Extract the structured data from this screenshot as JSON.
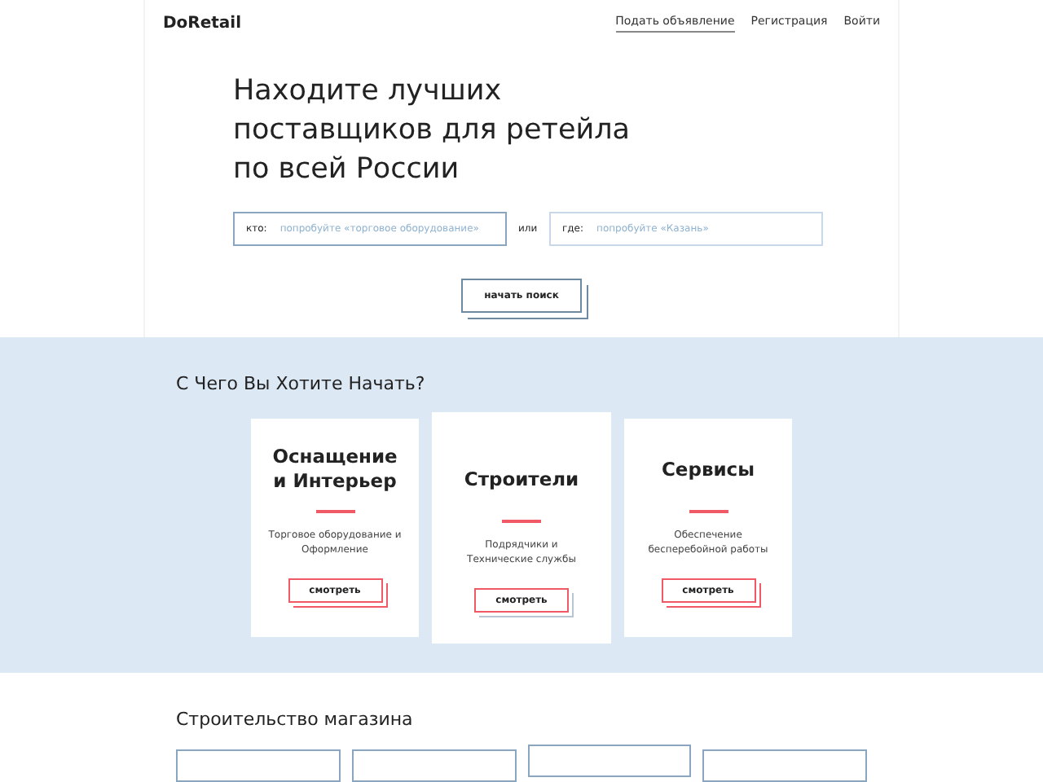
{
  "header": {
    "logo": "DoRetail",
    "nav": [
      {
        "label": "Подать объявление",
        "selected": true
      },
      {
        "label": "Регистрация",
        "selected": false
      },
      {
        "label": "Войти",
        "selected": false
      }
    ]
  },
  "hero": {
    "title": "Находите лучших поставщиков для ретейла по всей России",
    "who": {
      "label": "кто:",
      "placeholder": "попробуйте «торговое оборудование»"
    },
    "or": "или",
    "where": {
      "label": "где:",
      "placeholder": "попробуйте «Казань»"
    },
    "button": "начать поиск"
  },
  "start": {
    "heading": "С Чего Вы Хотите Начать?",
    "cards": [
      {
        "title": "Оснащение и Интерьер",
        "text": "Торговое оборудование и Оформление",
        "button": "смотреть",
        "selected": false
      },
      {
        "title": "Строители",
        "text": "Подрядчики и Технические службы",
        "button": "смотреть",
        "selected": true
      },
      {
        "title": "Сервисы",
        "text": "Обеспечение бесперебойной работы",
        "button": "смотреть",
        "selected": false
      }
    ]
  },
  "build": {
    "heading": "Строительство магазина",
    "cards": [
      {
        "selected": false
      },
      {
        "selected": false
      },
      {
        "selected": true
      },
      {
        "selected": false
      }
    ]
  }
}
